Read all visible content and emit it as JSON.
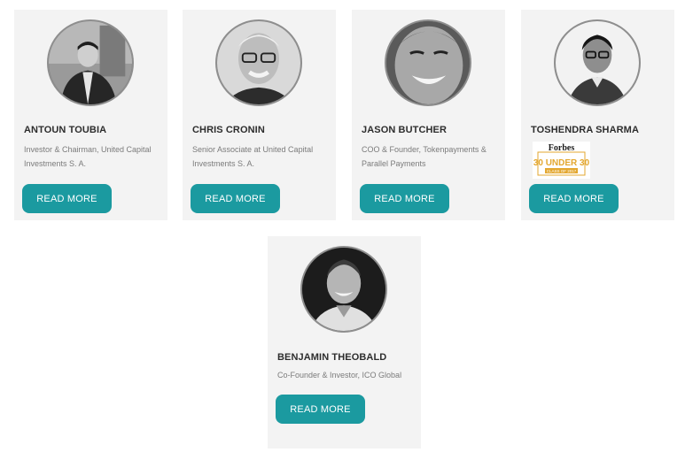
{
  "team": [
    {
      "name": "ANTOUN TOUBIA",
      "role": "Investor & Chairman, United Capital Investments S. A.",
      "button": "READ MORE",
      "photo_icon": "person-photo"
    },
    {
      "name": "CHRIS CRONIN",
      "role": "Senior Associate at United Capital Investments S. A.",
      "button": "READ MORE",
      "photo_icon": "person-photo"
    },
    {
      "name": "JASON BUTCHER",
      "role": "COO & Founder, Tokenpayments & Parallel Payments",
      "button": "READ MORE",
      "photo_icon": "person-photo"
    },
    {
      "name": "TOSHENDRA SHARMA",
      "role": "",
      "button": "READ MORE",
      "photo_icon": "person-photo",
      "badge": {
        "line1": "Forbes",
        "line2": "30 UNDER 30",
        "line3": "CLASS OF 2017"
      }
    },
    {
      "name": "BENJAMIN THEOBALD",
      "role": "Co-Founder & Investor, ICO Global",
      "button": "READ MORE",
      "photo_icon": "person-photo"
    }
  ],
  "colors": {
    "button": "#1b9aa0",
    "card": "#f3f3f3",
    "name": "#2d2d2d",
    "role": "#7b7b7b"
  }
}
